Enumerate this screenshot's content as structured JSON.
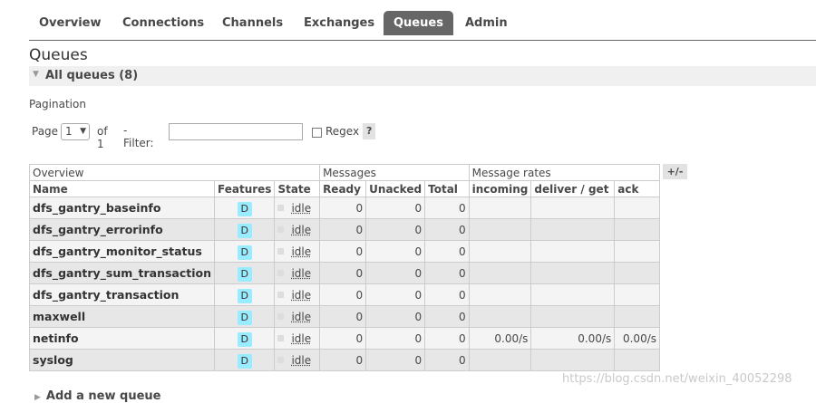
{
  "nav": {
    "tabs": [
      {
        "label": "Overview",
        "active": false
      },
      {
        "label": "Connections",
        "active": false
      },
      {
        "label": "Channels",
        "active": false
      },
      {
        "label": "Exchanges",
        "active": false
      },
      {
        "label": "Queues",
        "active": true
      },
      {
        "label": "Admin",
        "active": false
      }
    ]
  },
  "page": {
    "title": "Queues",
    "section": "All queues (8)",
    "pagination_label": "Pagination"
  },
  "controls": {
    "page_label": "Page",
    "page_value": "1",
    "of_label": "of 1",
    "filter_label": "- Filter:",
    "filter_value": "",
    "regex_label": "Regex",
    "help": "?"
  },
  "table": {
    "groups": [
      "Overview",
      "Messages",
      "Message rates"
    ],
    "columns": [
      "Name",
      "Features",
      "State",
      "Ready",
      "Unacked",
      "Total",
      "incoming",
      "deliver / get",
      "ack"
    ],
    "plus_minus": "+/-",
    "rows": [
      {
        "name": "dfs_gantry_baseinfo",
        "feature": "D",
        "state": "idle",
        "ready": "0",
        "unacked": "0",
        "total": "0",
        "incoming": "",
        "deliver": "",
        "ack": ""
      },
      {
        "name": "dfs_gantry_errorinfo",
        "feature": "D",
        "state": "idle",
        "ready": "0",
        "unacked": "0",
        "total": "0",
        "incoming": "",
        "deliver": "",
        "ack": ""
      },
      {
        "name": "dfs_gantry_monitor_status",
        "feature": "D",
        "state": "idle",
        "ready": "0",
        "unacked": "0",
        "total": "0",
        "incoming": "",
        "deliver": "",
        "ack": ""
      },
      {
        "name": "dfs_gantry_sum_transaction",
        "feature": "D",
        "state": "idle",
        "ready": "0",
        "unacked": "0",
        "total": "0",
        "incoming": "",
        "deliver": "",
        "ack": ""
      },
      {
        "name": "dfs_gantry_transaction",
        "feature": "D",
        "state": "idle",
        "ready": "0",
        "unacked": "0",
        "total": "0",
        "incoming": "",
        "deliver": "",
        "ack": ""
      },
      {
        "name": "maxwell",
        "feature": "D",
        "state": "idle",
        "ready": "0",
        "unacked": "0",
        "total": "0",
        "incoming": "",
        "deliver": "",
        "ack": ""
      },
      {
        "name": "netinfo",
        "feature": "D",
        "state": "idle",
        "ready": "0",
        "unacked": "0",
        "total": "0",
        "incoming": "0.00/s",
        "deliver": "0.00/s",
        "ack": "0.00/s"
      },
      {
        "name": "syslog",
        "feature": "D",
        "state": "idle",
        "ready": "0",
        "unacked": "0",
        "total": "0",
        "incoming": "",
        "deliver": "",
        "ack": ""
      }
    ]
  },
  "add_queue": "Add a new queue",
  "watermark": "https://blog.csdn.net/weixin_40052298",
  "colors": {
    "tab_active_bg": "#666666",
    "feature_badge": "#99ebff"
  }
}
